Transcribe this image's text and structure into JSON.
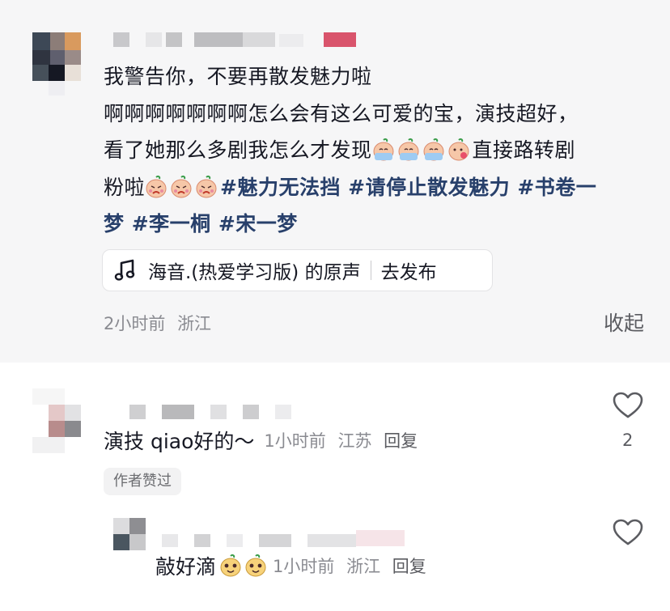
{
  "post": {
    "line1": "我警告你，不要再散发魅力啦",
    "line2": "啊啊啊啊啊啊啊怎么会有这么可爱的宝，演技超好，",
    "line3_text": "看了她那么多剧我怎么才发现",
    "line3_tail": "直接路转剧",
    "line4_text": "粉啦",
    "hashtags_line4": "#魅力无法挡 #请停止散发魅力 #书卷一",
    "hashtags_line5": "梦 #李一桐 #宋一梦",
    "music_title": "海音.(热爱学习版) 的原声",
    "music_action": "去发布",
    "time": "2小时前",
    "location": "浙江",
    "collapse_label": "收起"
  },
  "comments": [
    {
      "text": "演技 qiao好的～",
      "time": "1小时前",
      "location": "江苏",
      "reply_label": "回复",
      "like_count": "2",
      "badge": "作者赞过"
    },
    {
      "text": "敲好滴",
      "time": "1小时前",
      "location": "浙江",
      "reply_label": "回复"
    }
  ],
  "icons": {
    "music": "music-note-icon",
    "like": "heart-outline-icon",
    "emoji_cry": "crying-peach-emoji",
    "emoji_shy": "blushing-peach-emoji",
    "emoji_moved": "teary-peach-emoji",
    "emoji_happy": "happy-peach-emoji"
  },
  "colors": {
    "hashtag": "#28406b",
    "card_bg": "#f6f6f7",
    "meta_gray": "#8a8b91"
  }
}
